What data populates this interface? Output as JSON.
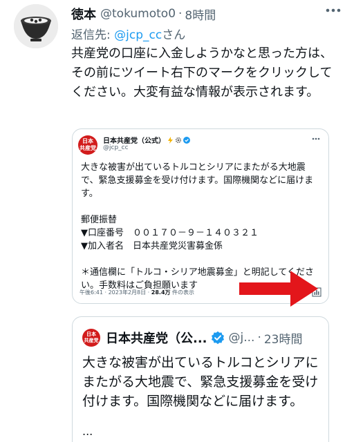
{
  "tweet": {
    "author_name": "徳本",
    "author_handle": "@tokumoto0",
    "separator": "·",
    "time": "8時間",
    "reply_prefix": "返信先: ",
    "reply_mention": "@jcp_cc",
    "reply_suffix": "さん",
    "text": "共産党の口座に入金しようかなと思った方は、その前にツイート右下のマークをクリックしてください。大変有益な情報が表示されます。",
    "more_icon": "more-horizontal-icon"
  },
  "screenshot": {
    "logo_text": "日本\n共産党",
    "name": "日本共産党（公式）",
    "handle": "@jcp_cc",
    "body_lines": [
      "大きな被害が出ているトルコとシリアにまたがる大地震で、緊急支援募金を受け付けます。国際機関などに届けます。",
      "",
      "郵便振替",
      "▼口座番号　００１７０－９－１４０３２１",
      "▼加入者名　日本共産党災害募金係",
      "",
      "＊通信欄に「トルコ・シリア地震募金」と明記してください。手数料はご負担願います"
    ],
    "meta_prefix": "午後6:41 · 2023年2月8日 · ",
    "meta_views": "28.4万",
    "meta_suffix": " 件の表示",
    "analytics_icon": "analytics-icon",
    "arrow_color": "#e3161b"
  },
  "quote": {
    "logo_text": "日本\n共産党",
    "name": "日本共産党（公...",
    "handle": "@j...",
    "separator": "·",
    "time": "23時間",
    "text": "大きな被害が出ているトルコとシリアにまたがる大地震で、緊急支援募金を受け付けます。国際機関などに届けます。",
    "ellipsis": "...",
    "verified_color": "#1d9bf0"
  }
}
